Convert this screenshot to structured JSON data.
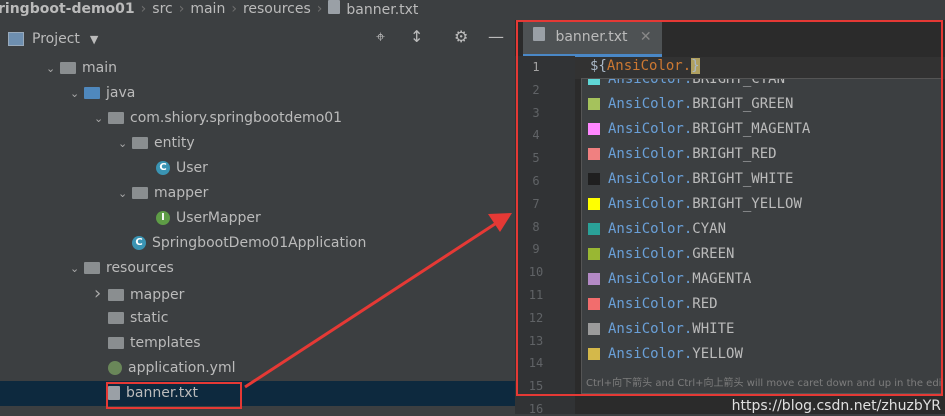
{
  "breadcrumb": [
    "ringboot-demo01",
    "src",
    "main",
    "resources",
    "banner.txt"
  ],
  "project": {
    "title": "Project"
  },
  "tree": [
    {
      "label": "main",
      "depth": 2,
      "arrow": "down",
      "icon": "folder"
    },
    {
      "label": "java",
      "depth": 3,
      "arrow": "down",
      "icon": "folder-blue"
    },
    {
      "label": "com.shiory.springbootdemo01",
      "depth": 4,
      "arrow": "down",
      "icon": "package"
    },
    {
      "label": "entity",
      "depth": 5,
      "arrow": "down",
      "icon": "package"
    },
    {
      "label": "User",
      "depth": 6,
      "arrow": "",
      "icon": "class",
      "letter": "C"
    },
    {
      "label": "mapper",
      "depth": 5,
      "arrow": "down",
      "icon": "package"
    },
    {
      "label": "UserMapper",
      "depth": 6,
      "arrow": "",
      "icon": "interface",
      "letter": "I"
    },
    {
      "label": "SpringbootDemo01Application",
      "depth": 5,
      "arrow": "",
      "icon": "app",
      "letter": "C"
    },
    {
      "label": "resources",
      "depth": 3,
      "arrow": "down",
      "icon": "folder"
    },
    {
      "label": "mapper",
      "depth": 4,
      "arrow": "right",
      "icon": "folder"
    },
    {
      "label": "static",
      "depth": 4,
      "arrow": "",
      "icon": "folder"
    },
    {
      "label": "templates",
      "depth": 4,
      "arrow": "",
      "icon": "folder"
    },
    {
      "label": "application.yml",
      "depth": 4,
      "arrow": "",
      "icon": "yml"
    },
    {
      "label": "banner.txt",
      "depth": 4,
      "arrow": "",
      "icon": "txt"
    }
  ],
  "editor": {
    "tab_label": "banner.txt",
    "code_prefix": "${",
    "code_class": "AnsiColor.",
    "code_suffix": "}",
    "line_numbers": [
      "1",
      "2",
      "3",
      "4",
      "5",
      "6",
      "7",
      "8",
      "9",
      "10",
      "11",
      "12",
      "13",
      "14",
      "15",
      "16"
    ]
  },
  "completion": {
    "items": [
      {
        "cls": "AnsiColor.",
        "val": "BRIGHT_CYAN",
        "color": "#5fd7d7"
      },
      {
        "cls": "AnsiColor.",
        "val": "BRIGHT_GREEN",
        "color": "#a5c25c"
      },
      {
        "cls": "AnsiColor.",
        "val": "BRIGHT_MAGENTA",
        "color": "#ff87ff"
      },
      {
        "cls": "AnsiColor.",
        "val": "BRIGHT_RED",
        "color": "#f08080"
      },
      {
        "cls": "AnsiColor.",
        "val": "BRIGHT_WHITE",
        "color": "#1f1f1f"
      },
      {
        "cls": "AnsiColor.",
        "val": "BRIGHT_YELLOW",
        "color": "#ffff00"
      },
      {
        "cls": "AnsiColor.",
        "val": "CYAN",
        "color": "#2aa198"
      },
      {
        "cls": "AnsiColor.",
        "val": "GREEN",
        "color": "#99b733"
      },
      {
        "cls": "AnsiColor.",
        "val": "MAGENTA",
        "color": "#b389c5"
      },
      {
        "cls": "AnsiColor.",
        "val": "RED",
        "color": "#f26d6d"
      },
      {
        "cls": "AnsiColor.",
        "val": "WHITE",
        "color": "#9b9b9b"
      },
      {
        "cls": "AnsiColor.",
        "val": "YELLOW",
        "color": "#d4b84a"
      }
    ],
    "hint": "Ctrl+向下箭头 and Ctrl+向上箭头 will move caret down and up in the editor"
  },
  "watermark": "https://blog.csdn.net/zhuzbYR"
}
